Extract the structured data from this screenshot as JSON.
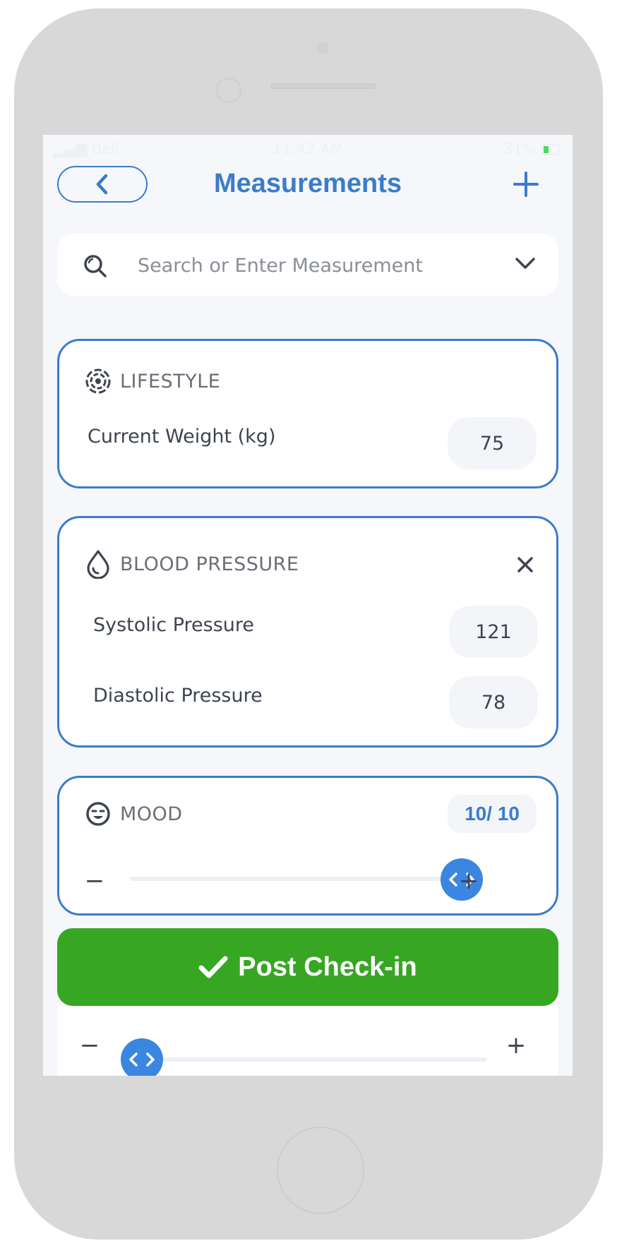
{
  "status_bar": {
    "carrier": "Bell",
    "time": "11:42 AM",
    "battery": "31%"
  },
  "header": {
    "title": "Measurements"
  },
  "search": {
    "placeholder": "Search or Enter Measurement"
  },
  "lifestyle": {
    "title": "LIFESTYLE",
    "weight_label": "Current Weight (kg)",
    "weight_value": "75"
  },
  "blood_pressure": {
    "title": "BLOOD PRESSURE",
    "systolic_label": "Systolic Pressure",
    "systolic_value": "121",
    "diastolic_label": "Diastolic Pressure",
    "diastolic_value": "78"
  },
  "mood": {
    "title": "MOOD",
    "score": "10/ 10",
    "slider_value": 10,
    "slider_max": 10,
    "minus": "−",
    "plus": "+"
  },
  "post_button": {
    "label": "Post Check-in"
  },
  "lower_slider": {
    "value": 0,
    "minus": "−",
    "plus": "+"
  },
  "colors": {
    "accent": "#3b7cc9",
    "primary_button": "#37a623",
    "slider_thumb": "#3a86e0"
  }
}
